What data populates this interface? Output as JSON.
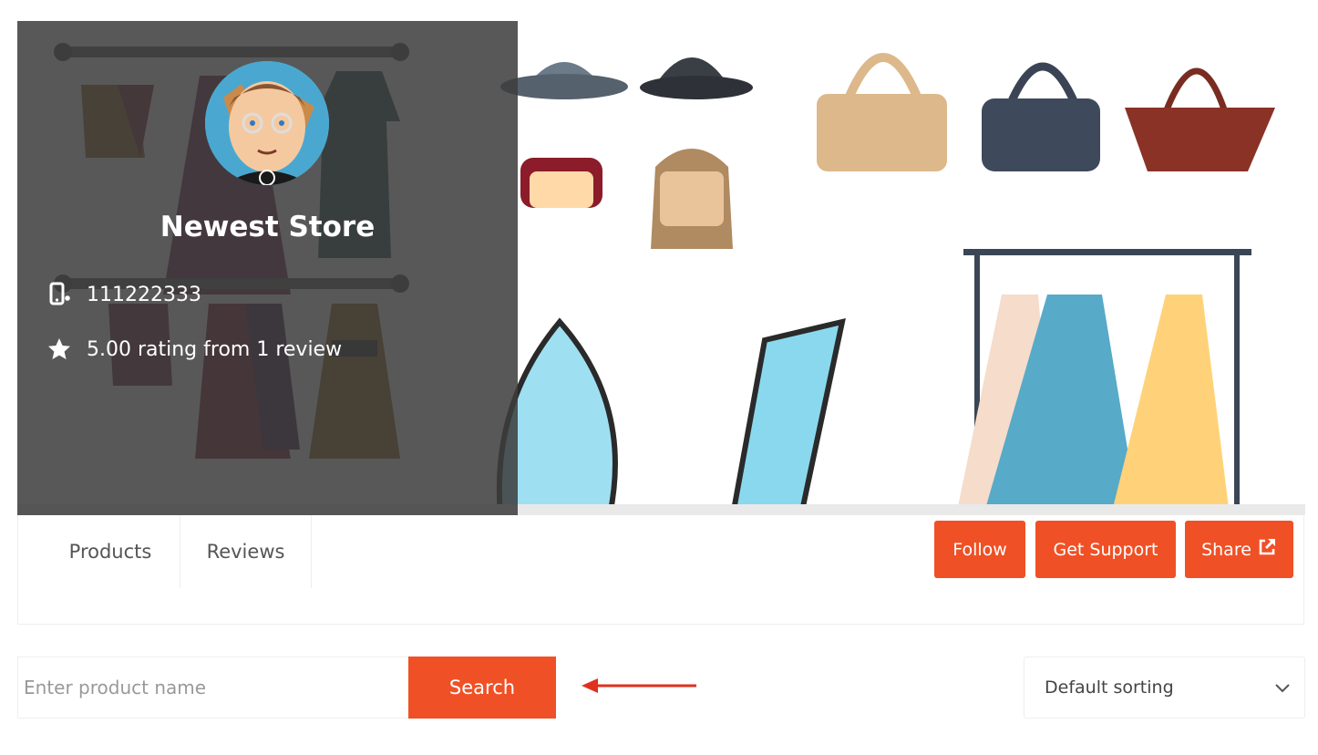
{
  "store": {
    "name": "Newest Store",
    "phone": "111222333",
    "rating_text": "5.00 rating from 1 review"
  },
  "tabs": [
    {
      "label": "Products"
    },
    {
      "label": "Reviews"
    }
  ],
  "actions": {
    "follow_label": "Follow",
    "support_label": "Get Support",
    "share_label": "Share"
  },
  "search": {
    "placeholder": "Enter product name",
    "button_label": "Search"
  },
  "sort": {
    "selected": "Default sorting"
  },
  "icons": {
    "phone": "mobile-phone-icon",
    "rating": "star-badge-icon",
    "share": "external-link-icon",
    "sort": "chevron-down-icon",
    "annotation": "left-arrow-icon"
  },
  "colors": {
    "accent": "#f05025",
    "overlay": "#3c3c3c"
  }
}
